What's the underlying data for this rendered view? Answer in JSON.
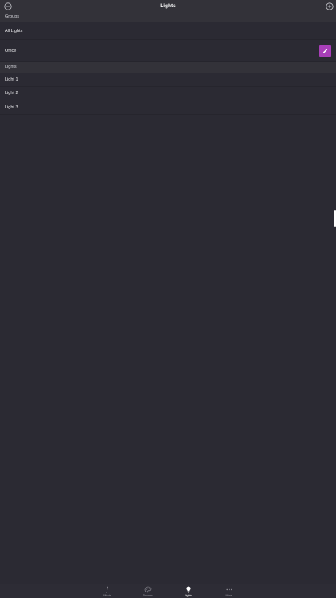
{
  "colors": {
    "accent": "#a83fb8",
    "background": "#2b2a33",
    "header": "#333239"
  },
  "nav": {
    "title": "Lights",
    "left_icon": "minus-circle-icon",
    "right_icon": "plus-circle-icon"
  },
  "groups": {
    "header": "Groups",
    "items": [
      {
        "label": "All Lights"
      },
      {
        "label": "Office",
        "edit_icon": "pencil-icon"
      }
    ]
  },
  "lights": {
    "header": "Lights",
    "items": [
      {
        "label": "Light 1"
      },
      {
        "label": "Light 2"
      },
      {
        "label": "Light 3"
      }
    ]
  },
  "tabs": [
    {
      "label": "Effects",
      "icon": "music-note-icon",
      "active": false
    },
    {
      "label": "Themes",
      "icon": "palette-icon",
      "active": false
    },
    {
      "label": "Lights",
      "icon": "lightbulb-icon",
      "active": true
    },
    {
      "label": "More",
      "icon": "ellipsis-icon",
      "active": false
    }
  ]
}
